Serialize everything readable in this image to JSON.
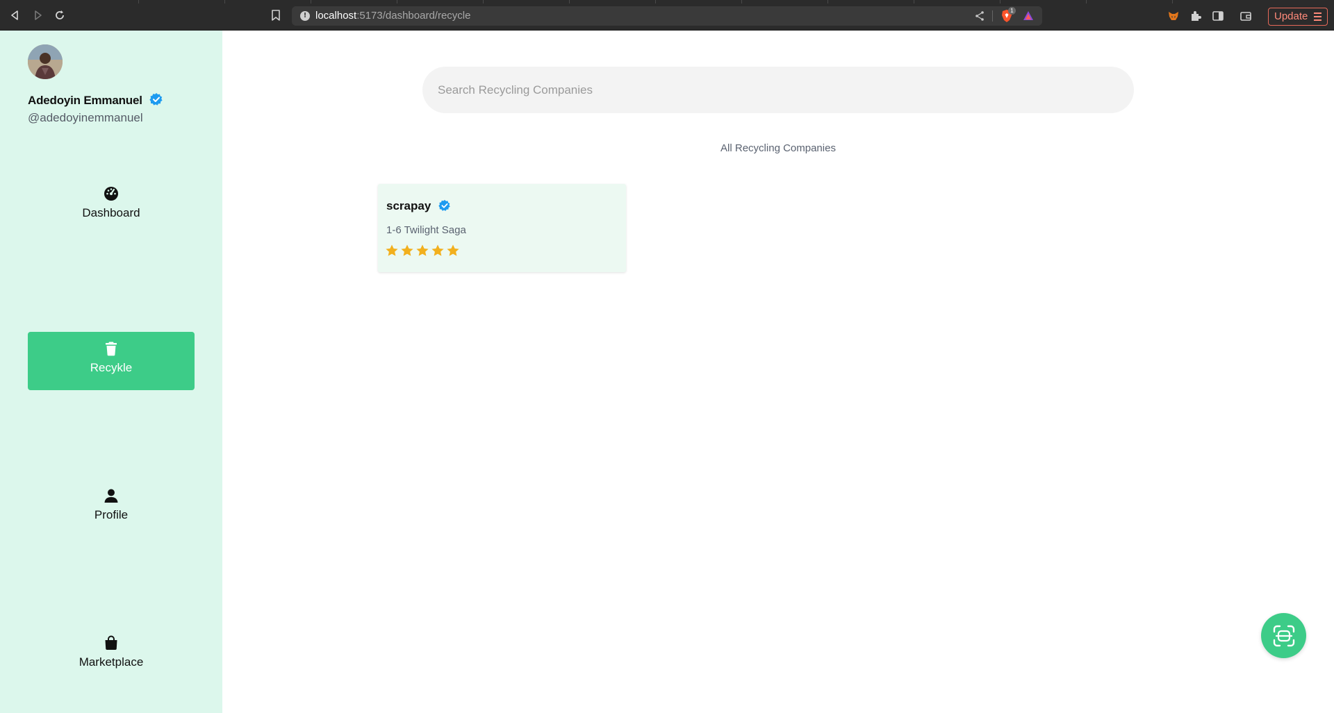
{
  "browser": {
    "url_host": "localhost",
    "url_path": ":5173/dashboard/recycle",
    "brave_badge": "1",
    "update_label": "Update"
  },
  "user": {
    "name": "Adedoyin Emmanuel",
    "handle": "@adedoyinemmanuel"
  },
  "sidebar": {
    "items": [
      {
        "label": "Dashboard",
        "icon": "dashboard-gauge-icon",
        "active": false
      },
      {
        "label": "Recykle",
        "icon": "trash-icon",
        "active": true
      },
      {
        "label": "Profile",
        "icon": "user-icon",
        "active": false
      },
      {
        "label": "Marketplace",
        "icon": "shopping-bag-icon",
        "active": false
      }
    ]
  },
  "search": {
    "placeholder": "Search Recycling Companies",
    "value": ""
  },
  "section_title": "All Recycling Companies",
  "companies": [
    {
      "name": "scrapay",
      "verified": true,
      "address": "1-6 Twilight Saga",
      "rating": 5
    }
  ],
  "colors": {
    "sidebar_bg": "#dcf7ec",
    "accent": "#3dcc88",
    "card_bg": "#ecf9f2",
    "star": "#f2b01e",
    "verified": "#1d9bf0"
  }
}
